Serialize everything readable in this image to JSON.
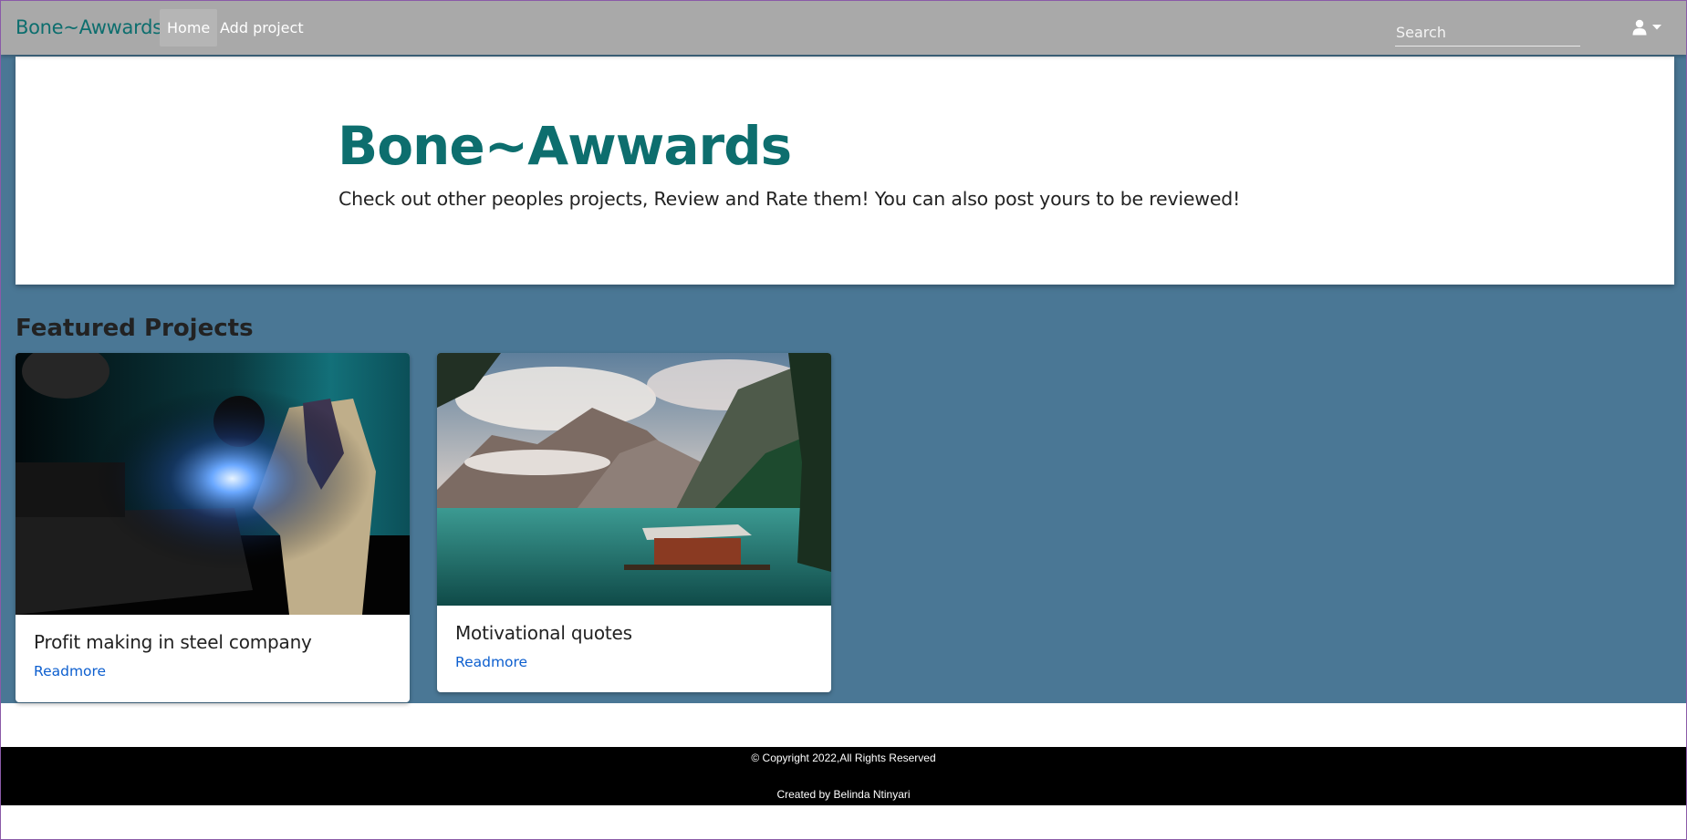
{
  "navbar": {
    "brand": "Bone~Awwards",
    "links": [
      {
        "label": "Home"
      },
      {
        "label": "Add project"
      }
    ],
    "search_placeholder": "Search",
    "user_icon": "user-icon",
    "caret_icon": "caret-down-icon"
  },
  "jumbotron": {
    "title": "Bone~Awwards",
    "lead": "Check out other peoples projects, Review and Rate them! You can also post yours to be reviewed!"
  },
  "featured": {
    "heading": "Featured Projects",
    "cards": [
      {
        "title": "Profit making in steel company",
        "link": "Readmore",
        "image": "welder-photo"
      },
      {
        "title": "Motivational quotes",
        "link": "Readmore",
        "image": "mountain-lake-photo"
      }
    ]
  },
  "footer": {
    "copyright": "© Copyright 2022,All Rights Reserved",
    "credit": "Created by Belinda Ntinyari"
  },
  "colors": {
    "navbar_bg": "#a9a9a9",
    "brand": "#0d6e6e",
    "main_bg": "#4a7795",
    "link": "#0d5fcf",
    "footer_bg": "#000000"
  }
}
